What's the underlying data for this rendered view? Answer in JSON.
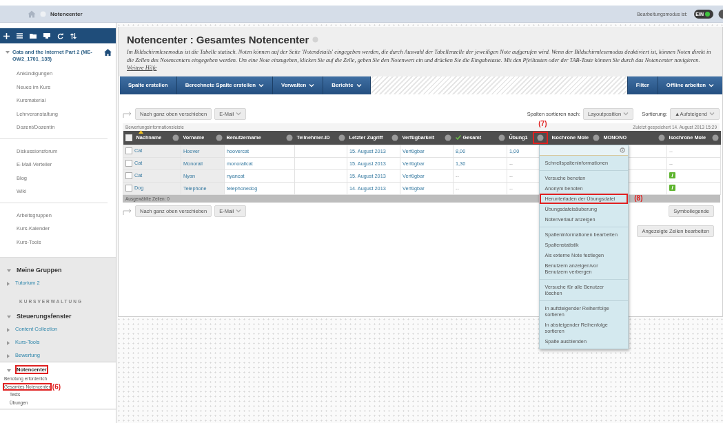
{
  "topbar": {
    "breadcrumb": "Notencenter",
    "edit_mode_label": "Bearbeitungsmodus ist:",
    "edit_mode": {
      "on": true,
      "text": "EIN"
    }
  },
  "sidebar": {
    "course_title": "Cats and the Internet Part 2 (ME-OW2_1701_135)",
    "menu_groups": [
      [
        "Ankündigungen",
        "Neues im Kurs",
        "Kursmaterial",
        "Lehrveranstaltung",
        "Dozent/Dozentin"
      ],
      [
        "Diskussionsforum",
        "E-Mail-Verteiler",
        "Blog",
        "Wiki"
      ],
      [
        "Arbeitsgruppen",
        "Kurs-Kalender",
        "Kurs-Tools"
      ]
    ],
    "my_groups": {
      "title": "Meine Gruppen",
      "expanded": true,
      "items": [
        {
          "label": "Tutorium 2",
          "expanded": false
        }
      ]
    },
    "admin_heading": "KURSVERWALTUNG",
    "control_panel": {
      "title": "Steuerungsfenster",
      "expanded": true,
      "items": [
        {
          "label": "Content Collection",
          "expanded": false,
          "highlighted": false
        },
        {
          "label": "Kurs-Tools",
          "expanded": false,
          "highlighted": false
        },
        {
          "label": "Bewertung",
          "expanded": false,
          "highlighted": false
        },
        {
          "label": "Notencenter",
          "expanded": true,
          "highlighted": true,
          "children": [
            {
              "label": "Benotung erforderlich",
              "highlighted": false
            },
            {
              "label": "Gesamtes Notencenter",
              "highlighted": true,
              "annotation": "(6)"
            },
            {
              "label": "Tests",
              "highlighted": false
            },
            {
              "label": "Übungen",
              "highlighted": false
            }
          ]
        }
      ]
    }
  },
  "page": {
    "title": "Notencenter : Gesamtes Notencenter",
    "description": "Im Bildschirmlesemodus ist die Tabelle statisch. Noten können auf der Seite 'Notendetails' eingegeben werden, die durch Auswahl der Tabellenzelle der jeweiligen Note aufgerufen wird. Wenn der Bildschirmlesemodus deaktiviert ist, können Noten direkt in die Zellen des Notencenters eingegeben werden. Um eine Note einzugeben, klicken Sie auf die Zelle, geben Sie den Notenwert ein und drücken Sie die Eingabetaste. Mit den Pfeiltasten oder der TAB-Taste können Sie durch das Notencenter navigieren.",
    "help_link": "Weitere Hilfe"
  },
  "action_bar": {
    "left": [
      {
        "label": "Spalte erstellen",
        "dropdown": false
      },
      {
        "label": "Berechnete Spalte erstellen",
        "dropdown": true
      },
      {
        "label": "Verwalten",
        "dropdown": true
      },
      {
        "label": "Berichte",
        "dropdown": true
      }
    ],
    "right": [
      {
        "label": "Filter",
        "dropdown": false
      },
      {
        "label": "Offline arbeiten",
        "dropdown": true
      }
    ]
  },
  "toolbar": {
    "move_top": "Nach ganz oben verschieben",
    "email": "E-Mail",
    "sort_label": "Spalten sortieren nach:",
    "sort_value": "Layoutposition",
    "order_label": "Sortierung:",
    "order_value": "▲Aufsteigend"
  },
  "info_bar": {
    "title": "Bewertungsinformationsleiste",
    "saved": "Zuletzt gespeichert 14. August 2013 15:29"
  },
  "table": {
    "all_selected": false,
    "columns": [
      {
        "label": "Nachname",
        "kind": "plain",
        "sorted": true,
        "highlighted": false
      },
      {
        "label": "Vorname",
        "kind": "plain",
        "sorted": false,
        "highlighted": false
      },
      {
        "label": "Benutzername",
        "kind": "plain",
        "sorted": false,
        "highlighted": false
      },
      {
        "label": "Teilnehmer-ID",
        "kind": "plain",
        "sorted": false,
        "highlighted": false
      },
      {
        "label": "Letzter Zugriff",
        "kind": "plain",
        "sorted": false,
        "highlighted": false
      },
      {
        "label": "Verfügbarkeit",
        "kind": "plain",
        "sorted": false,
        "highlighted": false
      },
      {
        "label": "Gesamt",
        "kind": "total",
        "sorted": false,
        "highlighted": false
      },
      {
        "label": "Übung1",
        "kind": "plain",
        "sorted": false,
        "highlighted": true,
        "annotation": "(7)"
      },
      {
        "label": "Isochrone Mole",
        "kind": "plain",
        "sorted": false,
        "highlighted": false
      },
      {
        "label": "MONONO",
        "kind": "plain",
        "sorted": false,
        "highlighted": false
      },
      {
        "label": "Isochrone Mole",
        "kind": "plain",
        "sorted": false,
        "highlighted": false
      }
    ],
    "rows": [
      {
        "selected": false,
        "cells": [
          "Cat",
          "Hoover",
          "hoovercat",
          null,
          "15. August 2013",
          "Verfügbar",
          "8,00",
          "1,00",
          null,
          null
        ],
        "last_cell": {
          "kind": "text",
          "text": "--"
        }
      },
      {
        "selected": false,
        "cells": [
          "Cat",
          "Monorail",
          "monorailcat",
          null,
          "15. August 2013",
          "Verfügbar",
          "1,30",
          "--",
          null,
          null
        ],
        "last_cell": {
          "kind": "text",
          "text": "--"
        }
      },
      {
        "selected": false,
        "cells": [
          "Cat",
          "Nyan",
          "nyancat",
          null,
          "15. August 2013",
          "Verfügbar",
          "--",
          "--",
          null,
          null
        ],
        "last_cell": {
          "kind": "needs_grading"
        }
      },
      {
        "selected": false,
        "cells": [
          "Dog",
          "Telephone",
          "telephonedog",
          null,
          "14. August 2013",
          "Verfügbar",
          "--",
          "--",
          null,
          null
        ],
        "last_cell": {
          "kind": "needs_grading"
        }
      }
    ],
    "footer": "Ausgewählte Zeilen: 0"
  },
  "column_menu": {
    "groups": [
      [
        {
          "label": "Schnellspalteninformationen",
          "highlighted": false
        }
      ],
      [
        {
          "label": "Versuche benoten",
          "highlighted": false
        },
        {
          "label": "Anonym benoten",
          "highlighted": false
        },
        {
          "label": "Herunterladen der Übungsdatei",
          "highlighted": true,
          "annotation": "(8)"
        },
        {
          "label": "Übungsdateisäuberung",
          "highlighted": false
        },
        {
          "label": "Notenverlauf anzeigen",
          "highlighted": false
        }
      ],
      [
        {
          "label": "Spalteninformationen bearbeiten",
          "highlighted": false
        },
        {
          "label": "Spaltenstatistik",
          "highlighted": false
        },
        {
          "label": "Als externe Note festlegen",
          "highlighted": false
        },
        {
          "label": "Benutzern anzeigen/vor Benutzern verbergen",
          "highlighted": false
        }
      ],
      [
        {
          "label": "Versuche für alle Benutzer löschen",
          "highlighted": false
        }
      ],
      [
        {
          "label": "In aufsteigender Reihenfolge sortieren",
          "highlighted": false
        },
        {
          "label": "In absteigender Reihenfolge sortieren",
          "highlighted": false
        },
        {
          "label": "Spalte ausblenden",
          "highlighted": false
        }
      ]
    ]
  },
  "bottom_toolbar": {
    "move_top": "Nach ganz oben verschieben",
    "email": "E-Mail",
    "legend": "Symbollegende",
    "edit_rows": "Angezeigte Zeilen bearbeiten"
  }
}
